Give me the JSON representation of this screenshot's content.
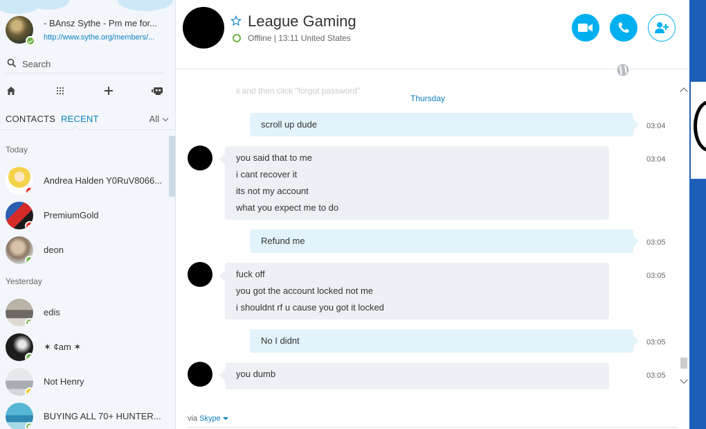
{
  "sidebar": {
    "profile": {
      "name": "- BAnsz Sythe - Pm me for...",
      "mood": "http://www.sythe.org/members/..."
    },
    "search": {
      "placeholder": "Search"
    },
    "tabs": {
      "contacts": "CONTACTS",
      "recent": "RECENT",
      "filter": "All"
    },
    "groups": {
      "today": "Today",
      "yesterday": "Yesterday"
    },
    "contacts": [
      {
        "name": "Andrea Halden Y0RuV8066...",
        "status": "busy"
      },
      {
        "name": "PremiumGold",
        "status": "busy"
      },
      {
        "name": "deon",
        "status": "online"
      },
      {
        "name": "edis",
        "status": "offline"
      },
      {
        "name": "✶ ¢am ✶",
        "status": "online"
      },
      {
        "name": "Not Henry",
        "status": "away"
      },
      {
        "name": "BUYING ALL 70+ HUNTER...",
        "status": "offline"
      }
    ]
  },
  "chat": {
    "title": "League Gaming",
    "status": "Offline  |  13:11 United States",
    "faded_text": "il and then click \"forgot password\"",
    "day_label": "Thursday",
    "messages": [
      {
        "direction": "out",
        "lines": [
          "scroll up dude"
        ],
        "time": "03:04"
      },
      {
        "direction": "in",
        "lines": [
          "you said that to me",
          "i cant recover it",
          "its not my account",
          "what you expect me to do"
        ],
        "time": "03:04"
      },
      {
        "direction": "out",
        "lines": [
          "Refund me"
        ],
        "time": "03:05"
      },
      {
        "direction": "in",
        "lines": [
          "fuck off",
          "you got the account locked not me",
          "i shouldnt rf u cause you got it locked"
        ],
        "time": "03:05"
      },
      {
        "direction": "out",
        "lines": [
          "No I didnt"
        ],
        "time": "03:05"
      },
      {
        "direction": "in",
        "lines": [
          "you dumb"
        ],
        "time": "03:05"
      }
    ],
    "footer": {
      "via": "via",
      "service": "Skype"
    }
  },
  "colors": {
    "accent": "#00aff0",
    "link": "#0a7fbf",
    "online": "#6cb33f",
    "busy": "#e52019",
    "away": "#f7c400",
    "outgoing_bubble": "#e2f3fb",
    "incoming_bubble": "#edf0f4"
  },
  "icons": {
    "video_call": "video-camera-icon",
    "voice_call": "phone-icon",
    "add_people": "add-person-icon",
    "favorite": "star-icon",
    "translator": "globe-icon"
  }
}
